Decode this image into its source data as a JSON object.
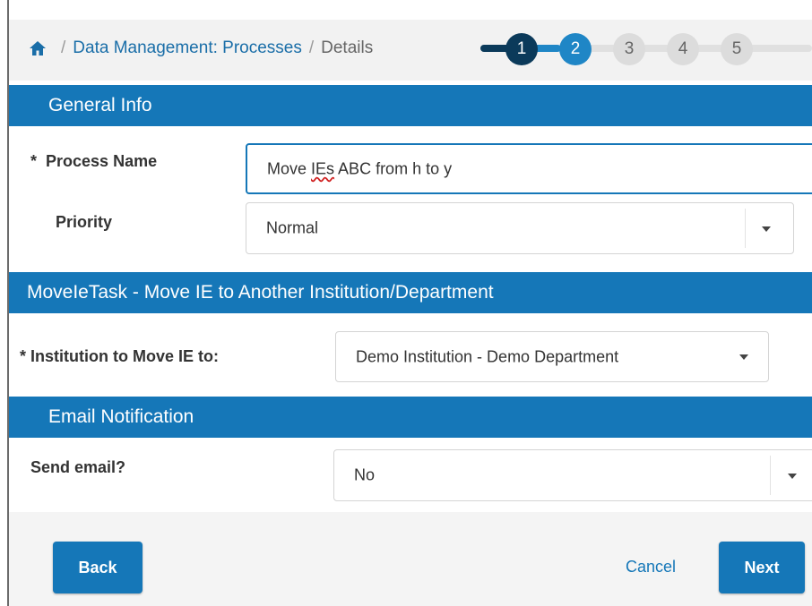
{
  "breadcrumb": {
    "home_icon": "home-icon",
    "items": [
      "Data Management: Processes",
      "Details"
    ],
    "separator": "/"
  },
  "steps": [
    "1",
    "2",
    "3",
    "4",
    "5"
  ],
  "current_step": 2,
  "sections": {
    "general": "General Info",
    "task": "MoveIeTask - Move IE to Another Institution/Department",
    "email": "Email Notification"
  },
  "fields": {
    "process_name": {
      "required_mark": "*",
      "label": "Process Name",
      "value_before": "Move ",
      "value_misspelled": "IEs",
      "value_after": " ABC from h to y"
    },
    "priority": {
      "label": "Priority",
      "value": "Normal"
    },
    "institution": {
      "label": "* Institution to Move IE to:",
      "value": "Demo Institution - Demo Department"
    },
    "send_email": {
      "label": "Send email?",
      "value": "No"
    }
  },
  "footer": {
    "back": "Back",
    "cancel": "Cancel",
    "next": "Next"
  },
  "colors": {
    "primary": "#1577b8",
    "step_done": "#0b3a5a",
    "step_active": "#1f86c6"
  }
}
